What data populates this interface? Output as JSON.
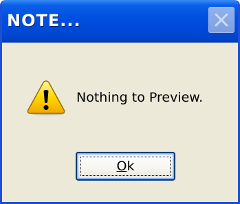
{
  "window": {
    "title": "NOTE...",
    "accent_color": "#0050e0",
    "background_color": "#ece9d8"
  },
  "titlebar": {
    "close_icon": "close-icon"
  },
  "dialog": {
    "icon": "warning-icon",
    "message": "Nothing to Preview."
  },
  "ok_button": {
    "label_accel": "O",
    "label_rest": "k"
  }
}
